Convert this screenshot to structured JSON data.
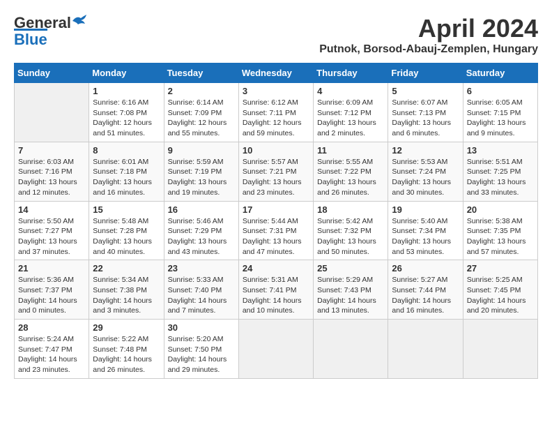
{
  "logo": {
    "general": "General",
    "blue": "Blue"
  },
  "title": "April 2024",
  "location": "Putnok, Borsod-Abauj-Zemplen, Hungary",
  "days_of_week": [
    "Sunday",
    "Monday",
    "Tuesday",
    "Wednesday",
    "Thursday",
    "Friday",
    "Saturday"
  ],
  "weeks": [
    [
      {
        "day": "",
        "info": ""
      },
      {
        "day": "1",
        "info": "Sunrise: 6:16 AM\nSunset: 7:08 PM\nDaylight: 12 hours\nand 51 minutes."
      },
      {
        "day": "2",
        "info": "Sunrise: 6:14 AM\nSunset: 7:09 PM\nDaylight: 12 hours\nand 55 minutes."
      },
      {
        "day": "3",
        "info": "Sunrise: 6:12 AM\nSunset: 7:11 PM\nDaylight: 12 hours\nand 59 minutes."
      },
      {
        "day": "4",
        "info": "Sunrise: 6:09 AM\nSunset: 7:12 PM\nDaylight: 13 hours\nand 2 minutes."
      },
      {
        "day": "5",
        "info": "Sunrise: 6:07 AM\nSunset: 7:13 PM\nDaylight: 13 hours\nand 6 minutes."
      },
      {
        "day": "6",
        "info": "Sunrise: 6:05 AM\nSunset: 7:15 PM\nDaylight: 13 hours\nand 9 minutes."
      }
    ],
    [
      {
        "day": "7",
        "info": "Sunrise: 6:03 AM\nSunset: 7:16 PM\nDaylight: 13 hours\nand 12 minutes."
      },
      {
        "day": "8",
        "info": "Sunrise: 6:01 AM\nSunset: 7:18 PM\nDaylight: 13 hours\nand 16 minutes."
      },
      {
        "day": "9",
        "info": "Sunrise: 5:59 AM\nSunset: 7:19 PM\nDaylight: 13 hours\nand 19 minutes."
      },
      {
        "day": "10",
        "info": "Sunrise: 5:57 AM\nSunset: 7:21 PM\nDaylight: 13 hours\nand 23 minutes."
      },
      {
        "day": "11",
        "info": "Sunrise: 5:55 AM\nSunset: 7:22 PM\nDaylight: 13 hours\nand 26 minutes."
      },
      {
        "day": "12",
        "info": "Sunrise: 5:53 AM\nSunset: 7:24 PM\nDaylight: 13 hours\nand 30 minutes."
      },
      {
        "day": "13",
        "info": "Sunrise: 5:51 AM\nSunset: 7:25 PM\nDaylight: 13 hours\nand 33 minutes."
      }
    ],
    [
      {
        "day": "14",
        "info": "Sunrise: 5:50 AM\nSunset: 7:27 PM\nDaylight: 13 hours\nand 37 minutes."
      },
      {
        "day": "15",
        "info": "Sunrise: 5:48 AM\nSunset: 7:28 PM\nDaylight: 13 hours\nand 40 minutes."
      },
      {
        "day": "16",
        "info": "Sunrise: 5:46 AM\nSunset: 7:29 PM\nDaylight: 13 hours\nand 43 minutes."
      },
      {
        "day": "17",
        "info": "Sunrise: 5:44 AM\nSunset: 7:31 PM\nDaylight: 13 hours\nand 47 minutes."
      },
      {
        "day": "18",
        "info": "Sunrise: 5:42 AM\nSunset: 7:32 PM\nDaylight: 13 hours\nand 50 minutes."
      },
      {
        "day": "19",
        "info": "Sunrise: 5:40 AM\nSunset: 7:34 PM\nDaylight: 13 hours\nand 53 minutes."
      },
      {
        "day": "20",
        "info": "Sunrise: 5:38 AM\nSunset: 7:35 PM\nDaylight: 13 hours\nand 57 minutes."
      }
    ],
    [
      {
        "day": "21",
        "info": "Sunrise: 5:36 AM\nSunset: 7:37 PM\nDaylight: 14 hours\nand 0 minutes."
      },
      {
        "day": "22",
        "info": "Sunrise: 5:34 AM\nSunset: 7:38 PM\nDaylight: 14 hours\nand 3 minutes."
      },
      {
        "day": "23",
        "info": "Sunrise: 5:33 AM\nSunset: 7:40 PM\nDaylight: 14 hours\nand 7 minutes."
      },
      {
        "day": "24",
        "info": "Sunrise: 5:31 AM\nSunset: 7:41 PM\nDaylight: 14 hours\nand 10 minutes."
      },
      {
        "day": "25",
        "info": "Sunrise: 5:29 AM\nSunset: 7:43 PM\nDaylight: 14 hours\nand 13 minutes."
      },
      {
        "day": "26",
        "info": "Sunrise: 5:27 AM\nSunset: 7:44 PM\nDaylight: 14 hours\nand 16 minutes."
      },
      {
        "day": "27",
        "info": "Sunrise: 5:25 AM\nSunset: 7:45 PM\nDaylight: 14 hours\nand 20 minutes."
      }
    ],
    [
      {
        "day": "28",
        "info": "Sunrise: 5:24 AM\nSunset: 7:47 PM\nDaylight: 14 hours\nand 23 minutes."
      },
      {
        "day": "29",
        "info": "Sunrise: 5:22 AM\nSunset: 7:48 PM\nDaylight: 14 hours\nand 26 minutes."
      },
      {
        "day": "30",
        "info": "Sunrise: 5:20 AM\nSunset: 7:50 PM\nDaylight: 14 hours\nand 29 minutes."
      },
      {
        "day": "",
        "info": ""
      },
      {
        "day": "",
        "info": ""
      },
      {
        "day": "",
        "info": ""
      },
      {
        "day": "",
        "info": ""
      }
    ]
  ]
}
